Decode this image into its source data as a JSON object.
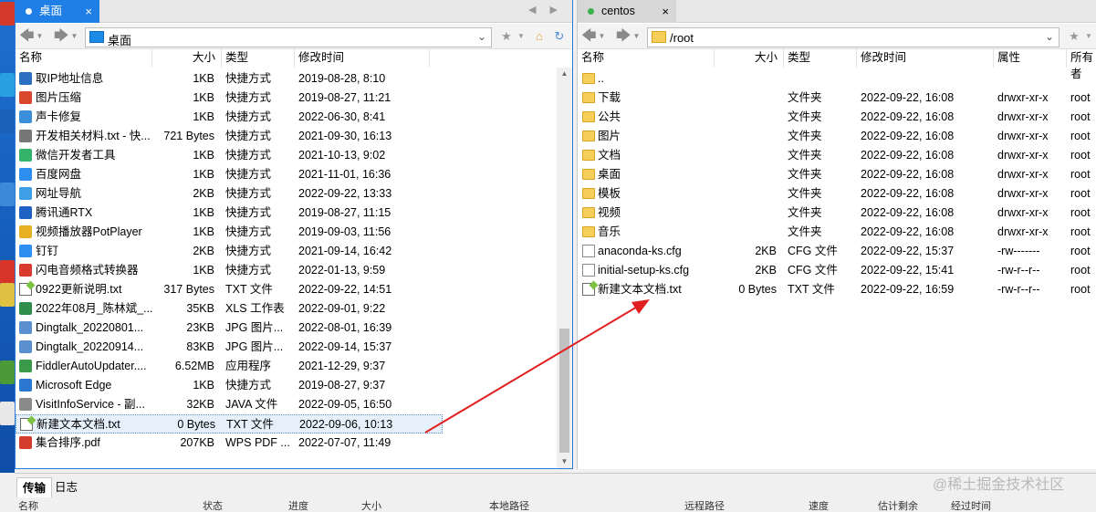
{
  "left_panel": {
    "tab_label": "桌面",
    "address": "桌面",
    "columns": [
      "名称",
      "大小",
      "类型",
      "修改时间"
    ],
    "files": [
      {
        "name": "取IP地址信息",
        "size": "1KB",
        "type": "快捷方式",
        "modified": "2019-08-28, 8:10",
        "icon": "shortcut-icon",
        "color": "#2b6fc0"
      },
      {
        "name": "图片压缩",
        "size": "1KB",
        "type": "快捷方式",
        "modified": "2019-08-27, 11:21",
        "icon": "shortcut-icon",
        "color": "#d9462c"
      },
      {
        "name": "声卡修复",
        "size": "1KB",
        "type": "快捷方式",
        "modified": "2022-06-30, 8:41",
        "icon": "shortcut-icon",
        "color": "#3a8fd8"
      },
      {
        "name": "开发相关材料.txt - 快...",
        "size": "721 Bytes",
        "type": "快捷方式",
        "modified": "2021-09-30, 16:13",
        "icon": "shortcut-icon",
        "color": "#777777"
      },
      {
        "name": "微信开发者工具",
        "size": "1KB",
        "type": "快捷方式",
        "modified": "2021-10-13, 9:02",
        "icon": "shortcut-icon",
        "color": "#35b36a"
      },
      {
        "name": "百度网盘",
        "size": "1KB",
        "type": "快捷方式",
        "modified": "2021-11-01, 16:36",
        "icon": "shortcut-icon",
        "color": "#2d8ef0"
      },
      {
        "name": "网址导航",
        "size": "2KB",
        "type": "快捷方式",
        "modified": "2022-09-22, 13:33",
        "icon": "shortcut-icon",
        "color": "#3ea0e6"
      },
      {
        "name": "腾讯通RTX",
        "size": "1KB",
        "type": "快捷方式",
        "modified": "2019-08-27, 11:15",
        "icon": "shortcut-icon",
        "color": "#1e62c4"
      },
      {
        "name": "视频播放器PotPlayer",
        "size": "1KB",
        "type": "快捷方式",
        "modified": "2019-09-03, 11:56",
        "icon": "shortcut-icon",
        "color": "#e6b020"
      },
      {
        "name": "钉钉",
        "size": "2KB",
        "type": "快捷方式",
        "modified": "2021-09-14, 16:42",
        "icon": "shortcut-icon",
        "color": "#2f8ff0"
      },
      {
        "name": "闪电音频格式转换器",
        "size": "1KB",
        "type": "快捷方式",
        "modified": "2022-01-13, 9:59",
        "icon": "shortcut-icon",
        "color": "#d83a2e"
      },
      {
        "name": "0922更新说明.txt",
        "size": "317 Bytes",
        "type": "TXT 文件",
        "modified": "2022-09-22, 14:51",
        "icon": "txt-file-icon",
        "color": "#6a6a6a"
      },
      {
        "name": "2022年08月_陈林斌_...",
        "size": "35KB",
        "type": "XLS 工作表",
        "modified": "2022-09-01, 9:22",
        "icon": "xls-file-icon",
        "color": "#2f8f4a"
      },
      {
        "name": "Dingtalk_20220801...",
        "size": "23KB",
        "type": "JPG 图片...",
        "modified": "2022-08-01, 16:39",
        "icon": "jpg-file-icon",
        "color": "#5a8fd0"
      },
      {
        "name": "Dingtalk_20220914...",
        "size": "83KB",
        "type": "JPG 图片...",
        "modified": "2022-09-14, 15:37",
        "icon": "jpg-file-icon",
        "color": "#5a8fd0"
      },
      {
        "name": "FiddlerAutoUpdater....",
        "size": "6.52MB",
        "type": "应用程序",
        "modified": "2021-12-29, 9:37",
        "icon": "app-icon",
        "color": "#3a9a4a"
      },
      {
        "name": "Microsoft Edge",
        "size": "1KB",
        "type": "快捷方式",
        "modified": "2019-08-27, 9:37",
        "icon": "edge-icon",
        "color": "#2a78d0"
      },
      {
        "name": "VisitInfoService - 副...",
        "size": "32KB",
        "type": "JAVA 文件",
        "modified": "2022-09-05, 16:50",
        "icon": "java-file-icon",
        "color": "#8a8a8a"
      },
      {
        "name": "新建文本文档.txt",
        "size": "0 Bytes",
        "type": "TXT 文件",
        "modified": "2022-09-06, 10:13",
        "icon": "txt-file-icon",
        "color": "#6a6a6a",
        "selected": true
      },
      {
        "name": "集合排序.pdf",
        "size": "207KB",
        "type": "WPS PDF ...",
        "modified": "2022-07-07, 11:49",
        "icon": "pdf-file-icon",
        "color": "#d43c2c"
      }
    ]
  },
  "right_panel": {
    "tab_label": "centos",
    "address": "/root",
    "columns": [
      "名称",
      "大小",
      "类型",
      "修改时间",
      "属性",
      "所有者"
    ],
    "files": [
      {
        "name": "..",
        "size": "",
        "type": "",
        "modified": "",
        "attrs": "",
        "owner": "",
        "icon": "folder-icon"
      },
      {
        "name": "下载",
        "size": "",
        "type": "文件夹",
        "modified": "2022-09-22, 16:08",
        "attrs": "drwxr-xr-x",
        "owner": "root",
        "icon": "folder-icon"
      },
      {
        "name": "公共",
        "size": "",
        "type": "文件夹",
        "modified": "2022-09-22, 16:08",
        "attrs": "drwxr-xr-x",
        "owner": "root",
        "icon": "folder-icon"
      },
      {
        "name": "图片",
        "size": "",
        "type": "文件夹",
        "modified": "2022-09-22, 16:08",
        "attrs": "drwxr-xr-x",
        "owner": "root",
        "icon": "folder-icon"
      },
      {
        "name": "文档",
        "size": "",
        "type": "文件夹",
        "modified": "2022-09-22, 16:08",
        "attrs": "drwxr-xr-x",
        "owner": "root",
        "icon": "folder-icon"
      },
      {
        "name": "桌面",
        "size": "",
        "type": "文件夹",
        "modified": "2022-09-22, 16:08",
        "attrs": "drwxr-xr-x",
        "owner": "root",
        "icon": "folder-icon"
      },
      {
        "name": "模板",
        "size": "",
        "type": "文件夹",
        "modified": "2022-09-22, 16:08",
        "attrs": "drwxr-xr-x",
        "owner": "root",
        "icon": "folder-icon"
      },
      {
        "name": "视频",
        "size": "",
        "type": "文件夹",
        "modified": "2022-09-22, 16:08",
        "attrs": "drwxr-xr-x",
        "owner": "root",
        "icon": "folder-icon"
      },
      {
        "name": "音乐",
        "size": "",
        "type": "文件夹",
        "modified": "2022-09-22, 16:08",
        "attrs": "drwxr-xr-x",
        "owner": "root",
        "icon": "folder-icon"
      },
      {
        "name": "anaconda-ks.cfg",
        "size": "2KB",
        "type": "CFG 文件",
        "modified": "2022-09-22, 15:37",
        "attrs": "-rw-------",
        "owner": "root",
        "icon": "cfg-file-icon"
      },
      {
        "name": "initial-setup-ks.cfg",
        "size": "2KB",
        "type": "CFG 文件",
        "modified": "2022-09-22, 15:41",
        "attrs": "-rw-r--r--",
        "owner": "root",
        "icon": "cfg-file-icon"
      },
      {
        "name": "新建文本文档.txt",
        "size": "0 Bytes",
        "type": "TXT 文件",
        "modified": "2022-09-22, 16:59",
        "attrs": "-rw-r--r--",
        "owner": "root",
        "icon": "txt-file-icon"
      }
    ]
  },
  "bottom_panel": {
    "tabs": [
      "传输",
      "日志"
    ],
    "columns": [
      "名称",
      "状态",
      "进度",
      "大小",
      "本地路径",
      "远程路径",
      "速度",
      "估计剩余",
      "经过时间"
    ]
  },
  "watermark": "@稀土掘金技术社区",
  "colors": {
    "accent": "#1f7fe6",
    "arrow": "#e02020",
    "folder": "#f5cf5a"
  }
}
